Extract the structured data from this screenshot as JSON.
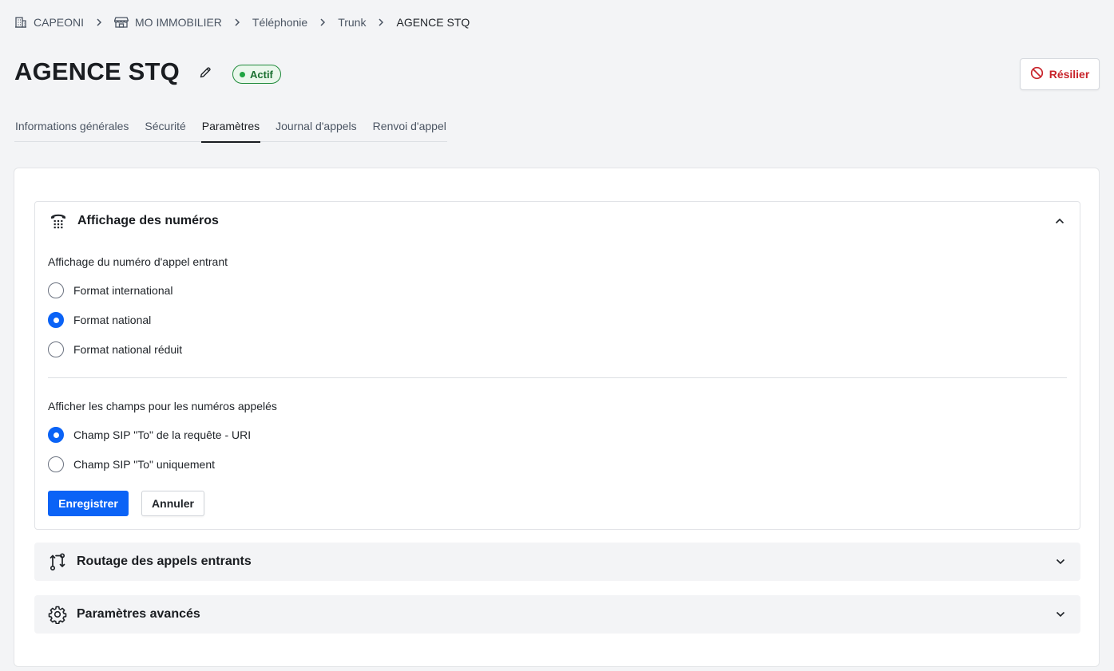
{
  "breadcrumb": [
    {
      "label": "CAPEONI",
      "icon": "building-icon"
    },
    {
      "label": "MO IMMOBILIER",
      "icon": "store-icon"
    },
    {
      "label": "Téléphonie"
    },
    {
      "label": "Trunk"
    },
    {
      "label": "AGENCE STQ",
      "current": true
    }
  ],
  "header": {
    "title": "AGENCE STQ",
    "status": "Actif",
    "terminate_label": "Résilier"
  },
  "tabs": [
    {
      "label": "Informations générales"
    },
    {
      "label": "Sécurité"
    },
    {
      "label": "Paramètres",
      "active": true
    },
    {
      "label": "Journal d'appels"
    },
    {
      "label": "Renvoi d'appel"
    }
  ],
  "panels": {
    "display": {
      "title": "Affichage des numéros",
      "icon": "phone-keypad-icon",
      "expanded": true,
      "incoming": {
        "label": "Affichage du numéro d'appel entrant",
        "options": [
          {
            "label": "Format international",
            "checked": false
          },
          {
            "label": "Format national",
            "checked": true
          },
          {
            "label": "Format national réduit",
            "checked": false
          }
        ]
      },
      "called": {
        "label": "Afficher les champs pour les numéros appelés",
        "options": [
          {
            "label": "Champ SIP \"To\" de la requête - URI",
            "checked": true
          },
          {
            "label": "Champ SIP \"To\" uniquement",
            "checked": false
          }
        ]
      },
      "save_label": "Enregistrer",
      "cancel_label": "Annuler"
    },
    "routing": {
      "title": "Routage des appels entrants",
      "icon": "routing-arrows-icon",
      "expanded": false
    },
    "advanced": {
      "title": "Paramètres avancés",
      "icon": "gear-icon",
      "expanded": false
    }
  },
  "colors": {
    "primary": "#0b63f6",
    "danger": "#c8242b",
    "success": "#1fa541"
  }
}
